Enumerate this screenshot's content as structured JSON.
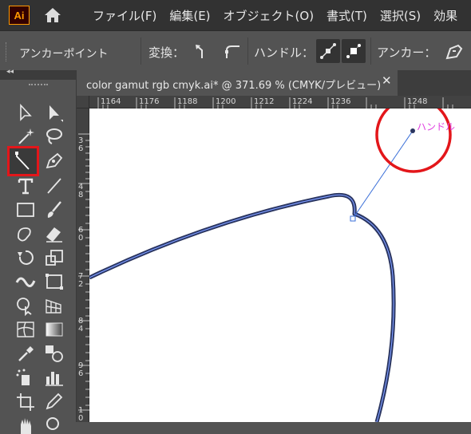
{
  "menubar": {
    "logo": "Ai",
    "items": [
      "ファイル(F)",
      "編集(E)",
      "オブジェクト(O)",
      "書式(T)",
      "選択(S)",
      "効果"
    ]
  },
  "controlbar": {
    "title": "アンカーポイント",
    "convert_label": "変換：",
    "handle_label": "ハンドル：",
    "anchor_label": "アンカー："
  },
  "toolbox": {
    "collapse_glyph": "◂◂"
  },
  "document": {
    "tab_title": "color gamut rgb cmyk.ai* @ 371.69 % (CMYK/プレビュー)",
    "close_glyph": "✕"
  },
  "ruler": {
    "h_labels": [
      "1164",
      "1176",
      "1188",
      "1200",
      "1212",
      "1224",
      "1236",
      "1248"
    ],
    "v_labels": [
      "36",
      "48",
      "60",
      "72",
      "84",
      "96",
      "10"
    ]
  },
  "canvas": {
    "annotation": "ハンドル"
  },
  "colors": {
    "highlight": "#e3161a",
    "annotation": "#e040e0",
    "path": "#2a3560",
    "handle_line": "#3a6fd8"
  }
}
